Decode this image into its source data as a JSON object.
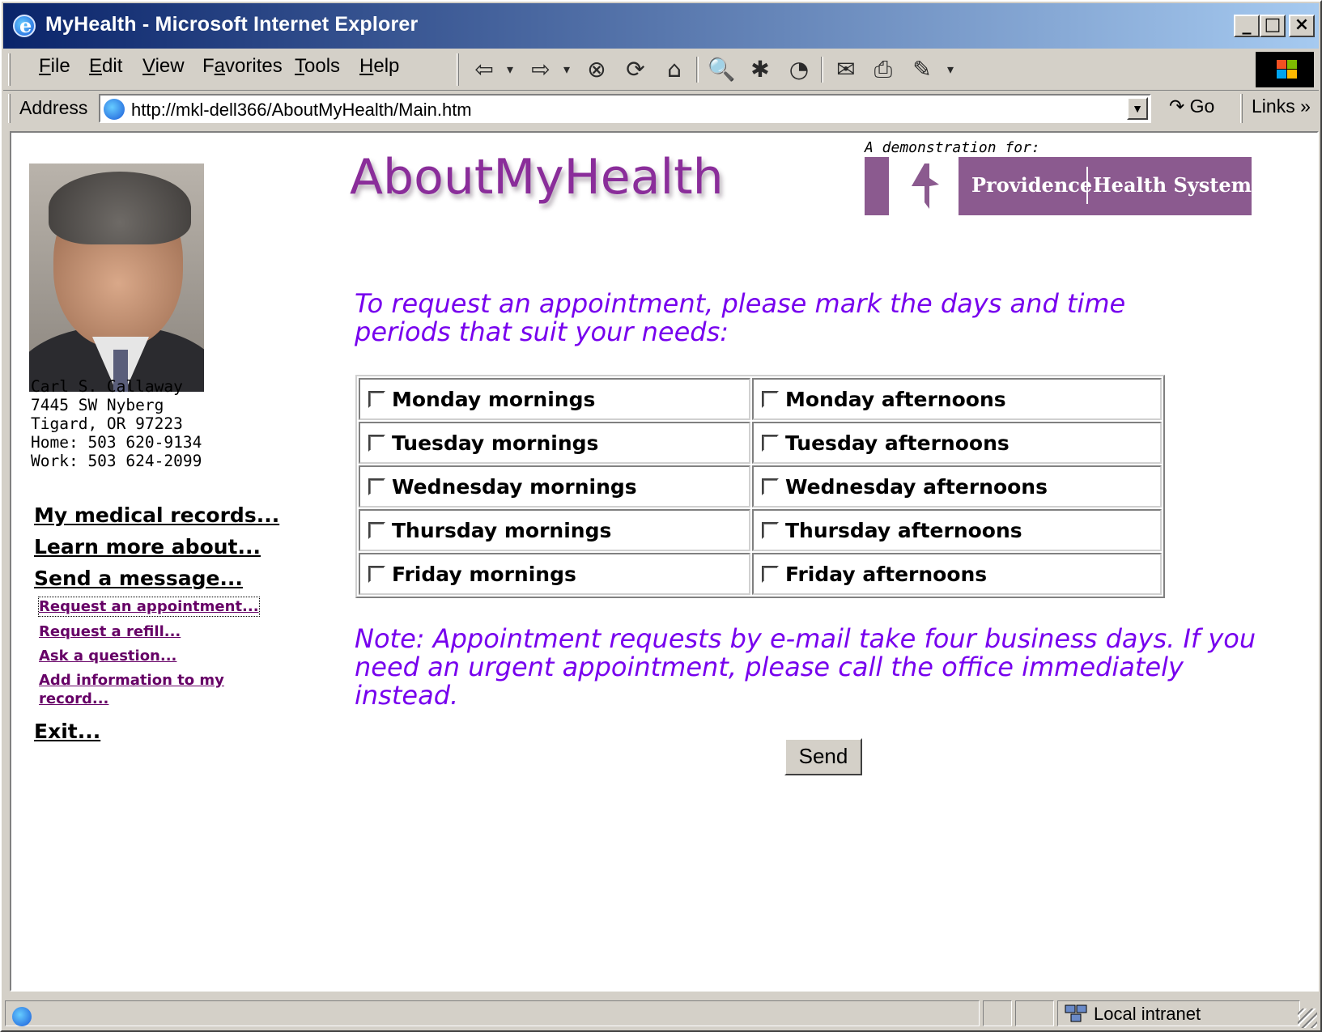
{
  "window": {
    "title": "MyHealth - Microsoft Internet Explorer"
  },
  "menu": {
    "items": [
      {
        "label": "File",
        "key": "F",
        "rest": "ile"
      },
      {
        "label": "Edit",
        "key": "E",
        "rest": "dit"
      },
      {
        "label": "View",
        "key": "V",
        "rest": "iew"
      },
      {
        "label": "Favorites",
        "pre": "F",
        "key": "a",
        "rest": "vorites"
      },
      {
        "label": "Tools",
        "key": "T",
        "rest": "ools"
      },
      {
        "label": "Help",
        "key": "H",
        "rest": "elp"
      }
    ]
  },
  "address": {
    "label": "Address",
    "url": "http://mkl-dell366/AboutMyHealth/Main.htm",
    "go": "Go",
    "links": "Links"
  },
  "patient": {
    "name": "Carl S. Callaway",
    "street": "7445 SW Nyberg",
    "city": "Tigard, OR 97223",
    "home": "Home: 503 620-9134",
    "work": "Work: 503 624-2099"
  },
  "nav": {
    "medical_records": "My medical records...",
    "learn_more": "Learn more about...",
    "send_message": "Send a message...",
    "sub": {
      "appointment": "Request an appointment...",
      "refill": "Request a refill...",
      "question": "Ask a question...",
      "add_info_1": "Add information to my",
      "add_info_2": "record..."
    },
    "exit": "Exit..."
  },
  "header": {
    "brand": "AboutMyHealth",
    "demo_label": "A demonstration for:",
    "logo_left": "Providence",
    "logo_right": "Health System"
  },
  "instructions": "To request an appointment, please mark the days and time periods that suit your needs:",
  "slots": [
    {
      "morning": "Monday mornings",
      "afternoon": "Monday afternoons"
    },
    {
      "morning": "Tuesday mornings",
      "afternoon": "Tuesday afternoons"
    },
    {
      "morning": "Wednesday mornings",
      "afternoon": "Wednesday afternoons"
    },
    {
      "morning": "Thursday mornings",
      "afternoon": "Thursday afternoons"
    },
    {
      "morning": "Friday mornings",
      "afternoon": "Friday afternoons"
    }
  ],
  "note": "Note: Appointment requests by e-mail take four business days. If you need an urgent appointment, please call the office immediately instead.",
  "send_label": "Send",
  "status": {
    "zone": "Local intranet"
  },
  "colors": {
    "brand": "#8a2d9a",
    "prompt": "#7700ee",
    "logo": "#8b5a8f",
    "sublink": "#660066"
  }
}
